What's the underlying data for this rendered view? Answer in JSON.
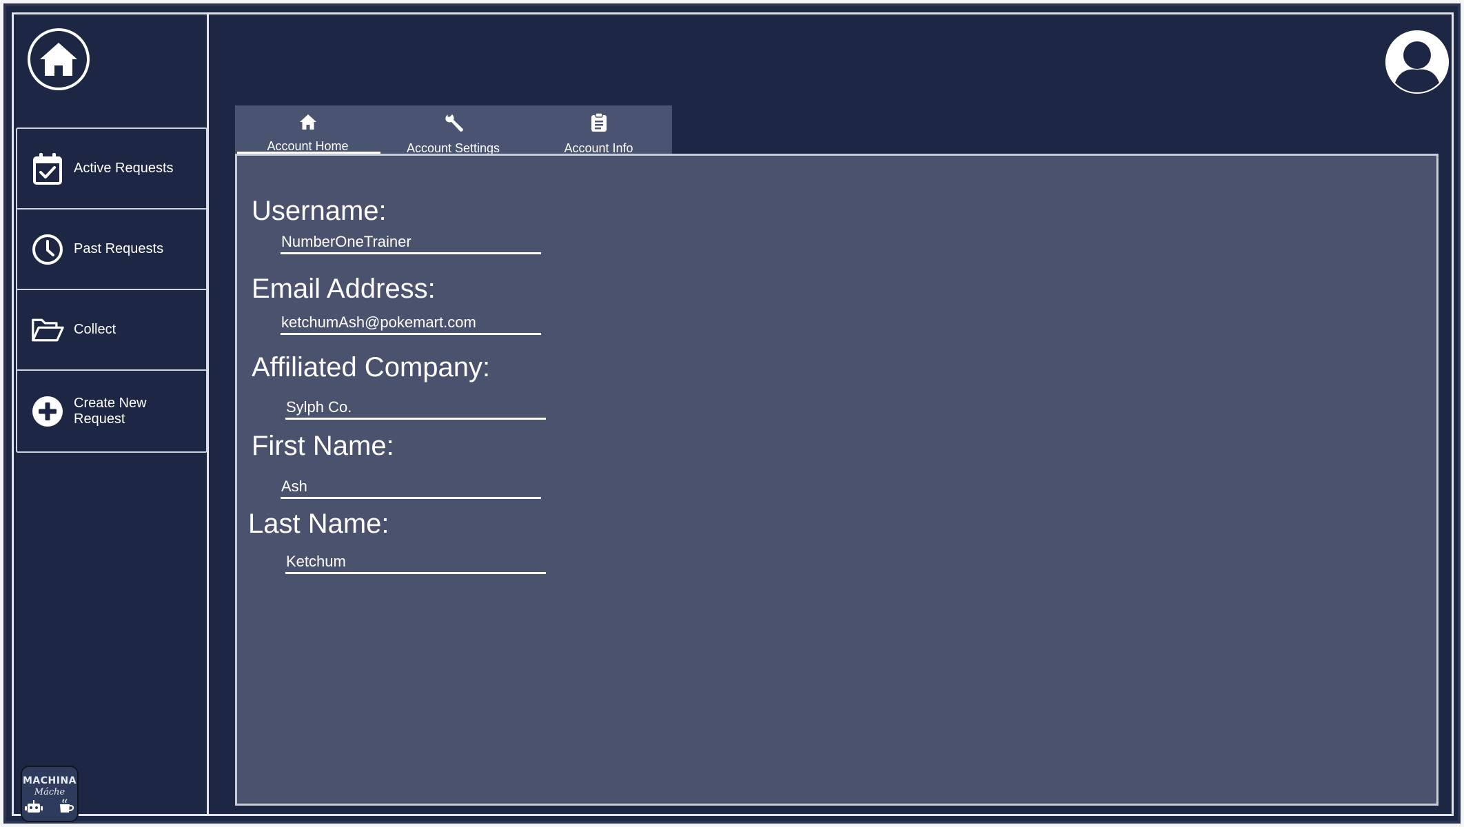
{
  "sidebar": {
    "items": [
      {
        "label": "Active Requests",
        "icon": "calendar-check-icon"
      },
      {
        "label": "Past Requests",
        "icon": "clock-icon"
      },
      {
        "label": "Collect",
        "icon": "folder-open-icon"
      },
      {
        "label": "Create New Request",
        "icon": "plus-circle-icon"
      }
    ]
  },
  "logo": {
    "top": "MACHINA",
    "bottom": "Máche"
  },
  "tabs": [
    {
      "label": "Account Home",
      "icon": "home-icon",
      "active": true
    },
    {
      "label": "Account Settings",
      "icon": "wrench-icon",
      "active": false
    },
    {
      "label": "Account Info",
      "icon": "clipboard-icon",
      "active": false
    }
  ],
  "fields": {
    "username": {
      "label": "Username:",
      "value": "NumberOneTrainer"
    },
    "email": {
      "label": "Email Address:",
      "value": "ketchumAsh@pokemart.com"
    },
    "company": {
      "label": "Affiliated Company:",
      "value": "Sylph Co."
    },
    "first_name": {
      "label": "First Name:",
      "value": "Ash"
    },
    "last_name": {
      "label": "Last Name:",
      "value": "Ketchum"
    }
  },
  "colors": {
    "background": "#1d2744",
    "panel": "#4a526e",
    "tab_bar": "#4a5370",
    "text": "#ffffff"
  }
}
